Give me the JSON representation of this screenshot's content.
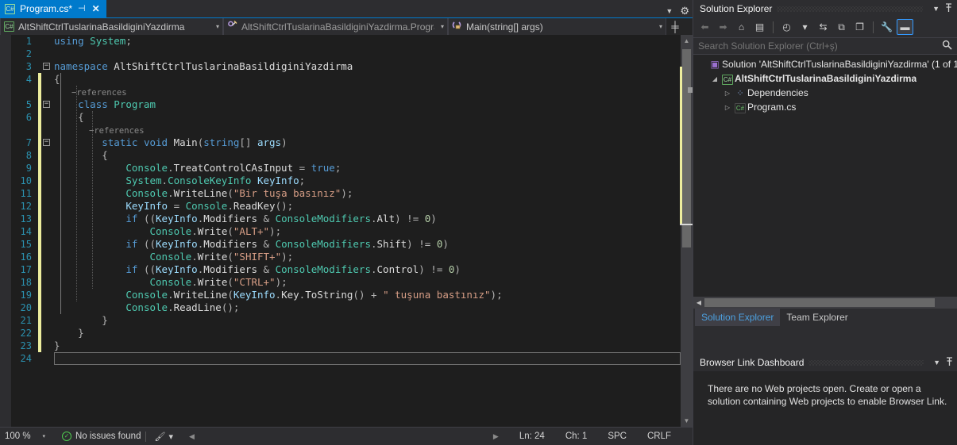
{
  "editor": {
    "tab": {
      "icon": "csharp-file-icon",
      "icon_glyph": "C#",
      "title": "Program.cs*",
      "pin_glyph": "⊣",
      "close_glyph": "✕"
    },
    "tabstrip_right": {
      "chevron_glyph": "▼",
      "gear_glyph": "⚙"
    },
    "navbar": {
      "project": "AltShiftCtrlTuslarinaBasildiginiYazdirma",
      "type": "AltShiftCtrlTuslarinaBasildiginiYazdirma.Progra",
      "member": "Main(string[] args)",
      "arrow_glyph": "▾",
      "split_glyph": "╪"
    },
    "code_lines": [
      {
        "num": "1",
        "changed": false,
        "fold": "",
        "codelens": null
      },
      {
        "num": "2",
        "changed": false,
        "fold": "",
        "codelens": null
      },
      {
        "num": "3",
        "changed": false,
        "fold": "−",
        "codelens": null
      },
      {
        "num": "4",
        "changed": true,
        "fold": "",
        "codelens": null
      },
      {
        "num": "5",
        "changed": true,
        "fold": "−",
        "codelens": "−references"
      },
      {
        "num": "6",
        "changed": true,
        "fold": "",
        "codelens": null
      },
      {
        "num": "7",
        "changed": true,
        "fold": "−",
        "codelens": "−references"
      },
      {
        "num": "8",
        "changed": true,
        "fold": "",
        "codelens": null
      },
      {
        "num": "9",
        "changed": true,
        "fold": "",
        "codelens": null
      },
      {
        "num": "10",
        "changed": true,
        "fold": "",
        "codelens": null
      },
      {
        "num": "11",
        "changed": true,
        "fold": "",
        "codelens": null
      },
      {
        "num": "12",
        "changed": true,
        "fold": "",
        "codelens": null
      },
      {
        "num": "13",
        "changed": true,
        "fold": "",
        "codelens": null
      },
      {
        "num": "14",
        "changed": true,
        "fold": "",
        "codelens": null
      },
      {
        "num": "15",
        "changed": true,
        "fold": "",
        "codelens": null
      },
      {
        "num": "16",
        "changed": true,
        "fold": "",
        "codelens": null
      },
      {
        "num": "17",
        "changed": true,
        "fold": "",
        "codelens": null
      },
      {
        "num": "18",
        "changed": true,
        "fold": "",
        "codelens": null
      },
      {
        "num": "19",
        "changed": true,
        "fold": "",
        "codelens": null
      },
      {
        "num": "20",
        "changed": true,
        "fold": "",
        "codelens": null
      },
      {
        "num": "21",
        "changed": true,
        "fold": "",
        "codelens": null
      },
      {
        "num": "22",
        "changed": true,
        "fold": "",
        "codelens": null
      },
      {
        "num": "23",
        "changed": true,
        "fold": "",
        "codelens": null
      },
      {
        "num": "24",
        "changed": false,
        "fold": "",
        "codelens": null
      }
    ],
    "source_text": [
      "using System;",
      "",
      "namespace AltShiftCtrlTuslarinaBasildiginiYazdirma",
      "{",
      "    class Program",
      "    {",
      "        static void Main(string[] args)",
      "        {",
      "            Console.TreatControlCAsInput = true;",
      "            System.ConsoleKeyInfo KeyInfo;",
      "            Console.WriteLine(\"Bir tuşa basınız\");",
      "            KeyInfo = Console.ReadKey();",
      "            if ((KeyInfo.Modifiers & ConsoleModifiers.Alt) != 0)",
      "                Console.Write(\"ALT+\");",
      "            if ((KeyInfo.Modifiers & ConsoleModifiers.Shift) != 0)",
      "                Console.Write(\"SHIFT+\");",
      "            if ((KeyInfo.Modifiers & ConsoleModifiers.Control) != 0)",
      "                Console.Write(\"CTRL+\");",
      "            Console.WriteLine(KeyInfo.Key.ToString() + \" tuşuna bastınız\");",
      "            Console.ReadLine();",
      "        }",
      "    }",
      "}",
      ""
    ],
    "codelens_label": "−references",
    "scrollbar": {
      "up_glyph": "▲",
      "down_glyph": "▼"
    }
  },
  "statusbar": {
    "zoom": "100 %",
    "zoom_arrow": "▾",
    "issues": "No issues found",
    "issues_icon": "check-circle-icon",
    "brush_glyph": "🖌",
    "brush_arrow": "▾",
    "nav_left_glyph": "◀",
    "nav_right_glyph": "▶",
    "line": "Ln: 24",
    "col": "Ch: 1",
    "spaces": "SPC",
    "eol": "CRLF"
  },
  "solution_explorer": {
    "title": "Solution Explorer",
    "chevron_glyph": "▼",
    "pin_glyph": "📌",
    "toolbar": [
      {
        "name": "back-icon",
        "glyph": "⬅",
        "state": "dim",
        "label": "Back"
      },
      {
        "name": "forward-icon",
        "glyph": "➡",
        "state": "dim",
        "label": "Forward"
      },
      {
        "name": "home-icon",
        "glyph": "⌂",
        "state": "normal",
        "label": "Home"
      },
      {
        "name": "pending-changes-icon",
        "glyph": "▤",
        "state": "normal",
        "label": "Pending Changes"
      },
      {
        "name": "sep-1",
        "glyph": "",
        "state": "sep",
        "label": ""
      },
      {
        "name": "history-icon",
        "glyph": "◴",
        "state": "normal",
        "label": "History"
      },
      {
        "name": "history-dropdown-icon",
        "glyph": "▾",
        "state": "normal",
        "label": "History options"
      },
      {
        "name": "sync-icon",
        "glyph": "⇆",
        "state": "normal",
        "label": "Sync with Active Document"
      },
      {
        "name": "collapse-all-icon",
        "glyph": "⧉",
        "state": "normal",
        "label": "Collapse All"
      },
      {
        "name": "show-all-files-icon",
        "glyph": "❐",
        "state": "normal",
        "label": "Show All Files"
      },
      {
        "name": "sep-2",
        "glyph": "",
        "state": "sep",
        "label": ""
      },
      {
        "name": "properties-icon",
        "glyph": "🔧",
        "state": "normal",
        "label": "Properties"
      },
      {
        "name": "preview-pane-icon",
        "glyph": "▬",
        "state": "active",
        "label": "Preview Selected Items"
      }
    ],
    "search_placeholder": "Search Solution Explorer (Ctrl+ş)",
    "search_value": "",
    "search_icon": "magnifier-icon",
    "tree": [
      {
        "twisty": "",
        "icon": "solution-icon",
        "icon_glyph": "▣",
        "label": "Solution 'AltShiftCtrlTuslarinaBasildiginiYazdirma' (1 of 1",
        "bold": false,
        "indent": 0
      },
      {
        "twisty": "◢",
        "icon": "csharp-project-icon",
        "icon_glyph": "C#",
        "label": "AltShiftCtrlTuslarinaBasildiginiYazdirma",
        "bold": true,
        "indent": 1
      },
      {
        "twisty": "▷",
        "icon": "dependencies-icon",
        "icon_glyph": "⁘",
        "label": "Dependencies",
        "bold": false,
        "indent": 2
      },
      {
        "twisty": "▷",
        "icon": "csharp-file-icon",
        "icon_glyph": "C#",
        "label": "Program.cs",
        "bold": false,
        "indent": 2
      }
    ],
    "hscroll_left_glyph": "◀",
    "tabs": [
      {
        "label": "Solution Explorer",
        "selected": true
      },
      {
        "label": "Team Explorer",
        "selected": false
      }
    ]
  },
  "browser_link": {
    "title": "Browser Link Dashboard",
    "chevron_glyph": "▼",
    "pin_glyph": "📌",
    "message": "There are no Web projects open. Create or open a solution containing Web projects to enable Browser Link."
  },
  "colors": {
    "accent": "#007acc",
    "editor_bg": "#1e1e1e",
    "chrome_bg": "#2d2d30",
    "panel_bg": "#252526",
    "change_bar": "#eded9e",
    "keyword": "#569cd6",
    "type": "#4ec9b0",
    "string": "#d69d85",
    "number": "#b5cea8",
    "identifier": "#9cdcfe",
    "linenum": "#2b91af"
  }
}
